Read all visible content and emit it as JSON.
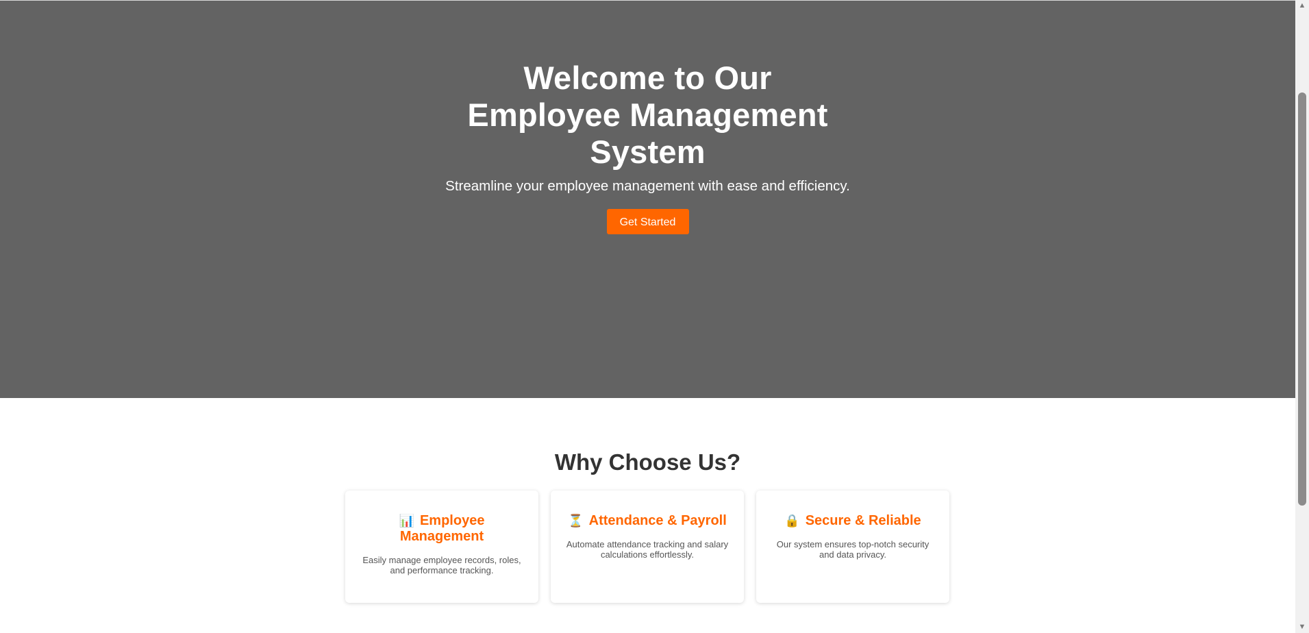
{
  "hero": {
    "title": "Welcome to Our Employee Management System",
    "subtitle": "Streamline your employee management with ease and efficiency.",
    "cta_label": "Get Started",
    "background_color": "#636363",
    "accent_color": "#ff6600"
  },
  "features": {
    "title": "Why Choose Us?",
    "cards": [
      {
        "icon": "chart-icon",
        "icon_glyph": "📊",
        "title": "Employee Management",
        "text": "Easily manage employee records, roles, and performance tracking."
      },
      {
        "icon": "hourglass-icon",
        "icon_glyph": "⏳",
        "title": "Attendance & Payroll",
        "text": "Automate attendance tracking and salary calculations effortlessly."
      },
      {
        "icon": "lock-icon",
        "icon_glyph": "🔒",
        "title": "Secure & Reliable",
        "text": "Our system ensures top-notch security and data privacy."
      }
    ]
  },
  "scrollbar": {
    "up_arrow": "▲",
    "down_arrow": "▼"
  }
}
